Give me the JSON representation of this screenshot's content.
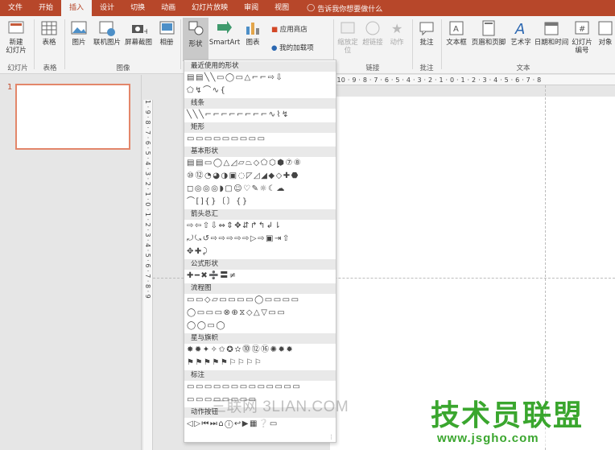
{
  "tabs": [
    "文件",
    "开始",
    "插入",
    "设计",
    "切换",
    "动画",
    "幻灯片放映",
    "审阅",
    "视图"
  ],
  "tell_me": "告诉我你想要做什么",
  "ribbon": {
    "new_slide": "新建\n幻灯片",
    "table": "表格",
    "picture": "图片",
    "online_picture": "联机图片",
    "screenshot": "屏幕截图",
    "album": "相册",
    "shapes": "形状",
    "smartart": "SmartArt",
    "chart": "图表",
    "app_store": "应用商店",
    "my_addins": "我的加载项",
    "zoom": "缩放定\n位",
    "hyperlink": "超链接",
    "action": "动作",
    "comment": "批注",
    "textbox": "文本框",
    "header_footer": "页眉和页脚",
    "wordart": "艺术字",
    "datetime": "日期和时间",
    "slide_number": "幻灯片\n编号",
    "object": "对象",
    "groups": {
      "slides": "幻灯片",
      "tables": "表格",
      "images": "图像",
      "links": "链接",
      "comments": "批注",
      "text": "文本"
    }
  },
  "slide_number": "1",
  "ruler_text": "1 · 10 · 9 · 8 · 7 · 6 · 5 · 4 · 3 · 2 · 1 · 0 · 1 · 2 · 3 · 4 · 5 · 6 · 7 · 8",
  "vruler_text": "1 · 9 · 8 · 7 · 6 · 5 · 4 · 3 · 2 · 1 · 0 · 1 · 2 · 3 · 4 · 5 · 6 · 7 · 8 · 9",
  "shapes_menu": [
    {
      "title": "最近使用的形状",
      "rows": [
        "▤▤╲╲▭◯▭△⌐⌐⇨⇩",
        "⬠↯⌒∿{"
      ]
    },
    {
      "title": "线条",
      "rows": [
        "╲╲╲⌐⌐⌐⌐⌐⌐⌐⌐∿⌇↯"
      ]
    },
    {
      "title": "矩形",
      "rows": [
        "▭▭▭▭▭▭▭▭▭"
      ]
    },
    {
      "title": "基本形状",
      "rows": [
        "▤▤▭◯△◿▱⏢◇⬠⬡⬢⑦⑧",
        "⑩⑫◔◕◑▣◌◸◿◢◆◇✚⬣",
        "◻◎◎◎◗▢☺♡✎☼☾☁",
        "⌒[]{}〔〕{}"
      ]
    },
    {
      "title": "箭头总汇",
      "rows": [
        "⇨⇦⇧⇩⇔⇕✥⇵↱↰↲⇂",
        "⤾⤿↺⇨⇨⇨⇨⇨▷⇨▣⇥⇧",
        "✥✚⤸"
      ]
    },
    {
      "title": "公式形状",
      "rows": [
        "✚━✖➗〓≠"
      ]
    },
    {
      "title": "流程图",
      "rows": [
        "▭▭◇▱▭▭▭▭◯▭▭▭▭",
        "◯▭▭▭⊗⊕⧖◇△▽▭▭",
        "◯◯▭◯"
      ]
    },
    {
      "title": "星与旗帜",
      "rows": [
        "✸✹✦✧✩✪✫⓾⑫⑯✺✹✹",
        "⚑⚑⚑⚑⚑⚐⚐⚐⚐"
      ]
    },
    {
      "title": "标注",
      "rows": [
        "▭▭▭▭▭▭▭▭▭▭▭▭▭",
        "▭▭▭▭▭▭▭▭"
      ]
    },
    {
      "title": "动作按钮",
      "rows": [
        "◁▷⏮⏭⌂ⓘ↩▶▦❔▭"
      ]
    }
  ],
  "watermark_site": "三联网 3LIAN.COM",
  "watermark_brand": "技术员联盟",
  "watermark_url": "www.jsgho.com"
}
